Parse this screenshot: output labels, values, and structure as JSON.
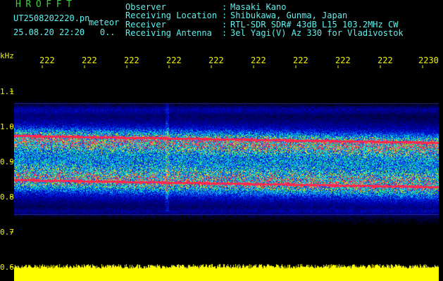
{
  "header": {
    "brand": "HROFFT",
    "filename": "UT2508202220.pn",
    "mode": "meteor",
    "datetime": "25.08.20 22:20",
    "extra": "0..",
    "fields": [
      {
        "label": "Observer",
        "value": "Masaki Kano"
      },
      {
        "label": "Receiving Location",
        "value": "Shibukawa, Gunma, Japan"
      },
      {
        "label": "Receiver",
        "value": "RTL-SDR SDR# 43dB L15 103.2MHz CW"
      },
      {
        "label": "Receiving Antenna",
        "value": "3el Yagi(V) Az 330 for Vladivostok"
      }
    ]
  },
  "axis": {
    "unit": "kHz",
    "y_ticks": [
      "1.1",
      "1.0",
      "0.9",
      "0.8",
      "0.7",
      "0.6"
    ],
    "x_ticks": [
      "222",
      "222",
      "222",
      "222",
      "222",
      "222",
      "222",
      "222",
      "222",
      "2230"
    ]
  },
  "colors": {
    "text_cyan": "#5ff2ee",
    "text_yellow": "#f2f200",
    "brand_green": "#3ccf3c",
    "background": "#000000",
    "signal_red": "#ff2a4a",
    "noise_blue": "#1a1fd0",
    "baseline_yellow": "#ffff00"
  }
}
